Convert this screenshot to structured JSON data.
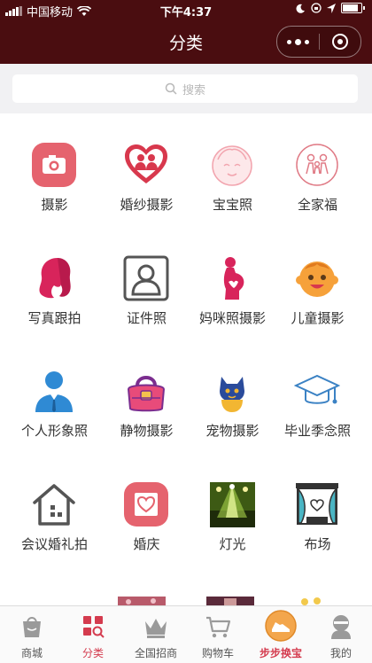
{
  "status_bar": {
    "carrier": "中国移动",
    "time": "下午4:37"
  },
  "nav": {
    "title": "分类"
  },
  "search": {
    "placeholder": "搜索"
  },
  "categories": [
    {
      "label": "摄影"
    },
    {
      "label": "婚纱摄影"
    },
    {
      "label": "宝宝照"
    },
    {
      "label": "全家福"
    },
    {
      "label": "写真跟拍"
    },
    {
      "label": "证件照"
    },
    {
      "label": "妈咪照摄影"
    },
    {
      "label": "儿童摄影"
    },
    {
      "label": "个人形象照"
    },
    {
      "label": "静物摄影"
    },
    {
      "label": "宠物摄影"
    },
    {
      "label": "毕业季念照"
    },
    {
      "label": "会议婚礼拍"
    },
    {
      "label": "婚庆"
    },
    {
      "label": "灯光"
    },
    {
      "label": "布场"
    }
  ],
  "tabbar": [
    {
      "label": "商城",
      "icon": "shopping-bag-icon"
    },
    {
      "label": "分类",
      "icon": "category-grid-icon"
    },
    {
      "label": "全国招商",
      "icon": "crown-icon"
    },
    {
      "label": "购物车",
      "icon": "cart-icon"
    },
    {
      "label": "步步换宝",
      "icon": "shoe-icon"
    },
    {
      "label": "我的",
      "icon": "user-icon"
    }
  ],
  "colors": {
    "nav_bg": "#4a0d10",
    "accent": "#d43b4e",
    "search_bg": "#f1f1f3"
  }
}
